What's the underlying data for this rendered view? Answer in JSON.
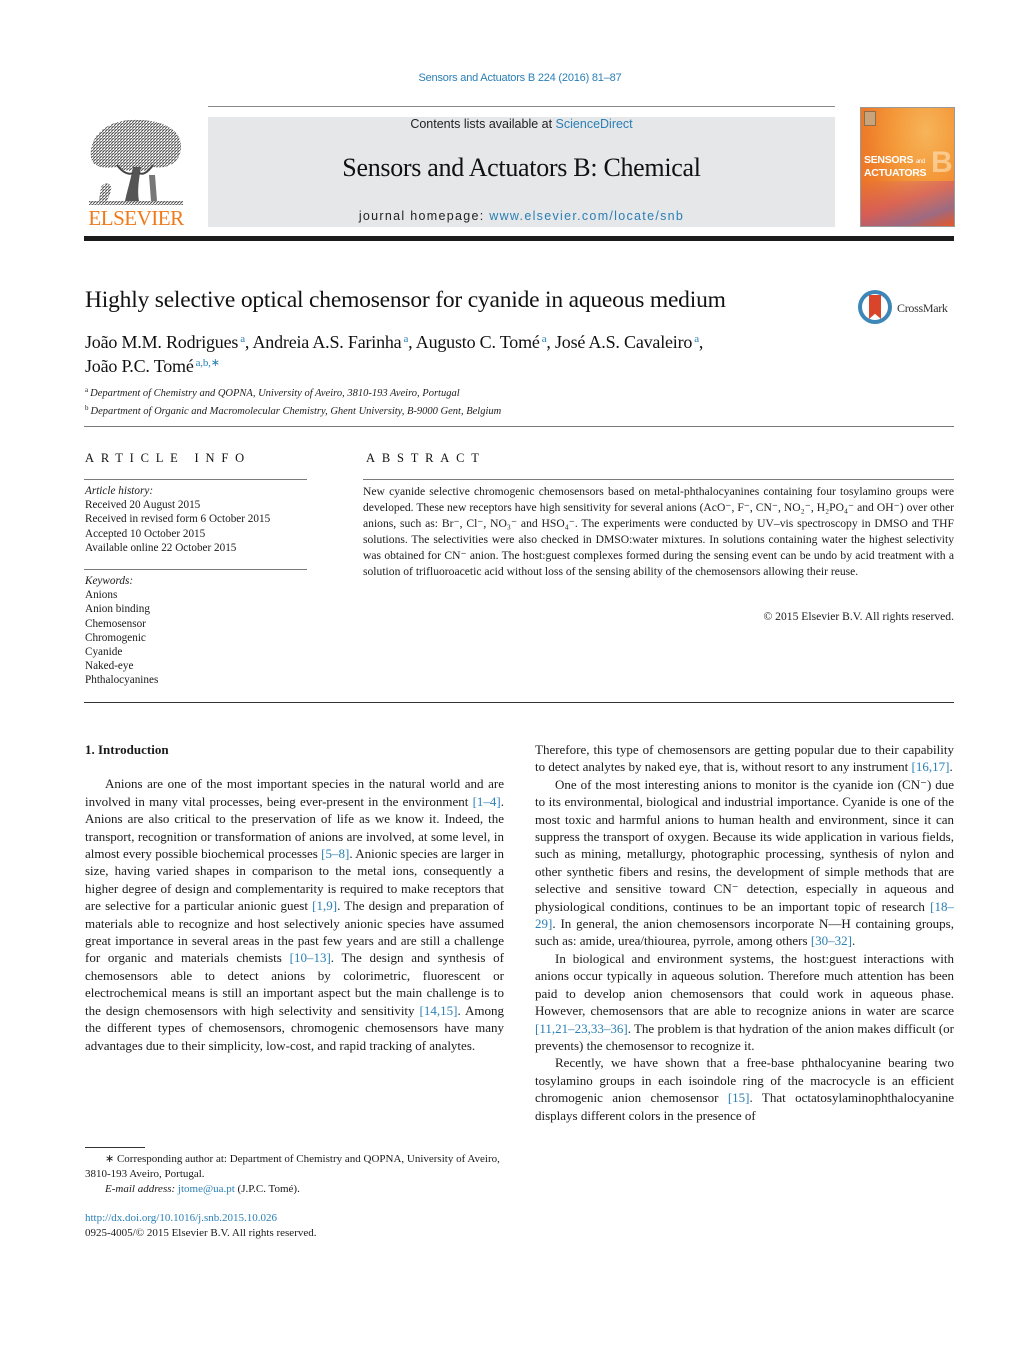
{
  "header": {
    "journal_ref": "Sensors and Actuators B 224 (2016) 81–87",
    "publisher_logo_text": "ELSEVIER",
    "contents_prefix": "Contents lists available at ",
    "contents_link": "ScienceDirect",
    "journal_title": "Sensors and Actuators B: Chemical",
    "homepage_prefix": "journal homepage: ",
    "homepage_link": "www.elsevier.com/locate/snb",
    "cover": {
      "line1": "SENSORS",
      "and": "and",
      "line2": "ACTUATORS",
      "letter": "B"
    }
  },
  "article": {
    "title": "Highly selective optical chemosensor for cyanide in aqueous medium",
    "crossmark_label": "CrossMark",
    "authors": [
      {
        "name": "João M.M. Rodrigues",
        "sup": "a",
        "sep": ", "
      },
      {
        "name": "Andreia A.S. Farinha",
        "sup": "a",
        "sep": ", "
      },
      {
        "name": "Augusto C. Tomé",
        "sup": "a",
        "sep": ", "
      },
      {
        "name": "José A.S. Cavaleiro",
        "sup": "a",
        "sep": ","
      },
      {
        "name": "João P.C. Tomé",
        "sup": "a,b,∗",
        "sep": ""
      }
    ],
    "affiliations": [
      {
        "key": "a",
        "text": "Department of Chemistry and QOPNA, University of Aveiro, 3810-193 Aveiro, Portugal"
      },
      {
        "key": "b",
        "text": "Department of Organic and Macromolecular Chemistry, Ghent University, B-9000 Gent, Belgium"
      }
    ]
  },
  "article_info": {
    "heading": "ARTICLE INFO",
    "history_label": "Article history:",
    "history": [
      "Received 20 August 2015",
      "Received in revised form 6 October 2015",
      "Accepted 10 October 2015",
      "Available online 22 October 2015"
    ],
    "keywords_label": "Keywords:",
    "keywords": [
      "Anions",
      "Anion binding",
      "Chemosensor",
      "Chromogenic",
      "Cyanide",
      "Naked-eye",
      "Phthalocyanines"
    ]
  },
  "abstract": {
    "heading": "ABSTRACT",
    "text": "New cyanide selective chromogenic chemosensors based on metal-phthalocyanines containing four tosylamino groups were developed. These new receptors have high sensitivity for several anions (AcO⁻, F⁻, CN⁻, NO₂⁻, H₂PO₄⁻ and OH⁻) over other anions, such as: Br⁻, Cl⁻, NO₃⁻ and HSO₄⁻. The experiments were conducted by UV–vis spectroscopy in DMSO and THF solutions. The selectivities were also checked in DMSO:water mixtures. In solutions containing water the highest selectivity was obtained for CN⁻ anion. The host:guest complexes formed during the sensing event can be undo by acid treatment with a solution of trifluoroacetic acid without loss of the sensing ability of the chemosensors allowing their reuse.",
    "copyright": "© 2015 Elsevier B.V. All rights reserved."
  },
  "body": {
    "section_heading": "1.  Introduction",
    "left_paragraphs": [
      [
        {
          "t": "Anions are one of the most important species in the natural world and are involved in many vital processes, being ever-present in the environment "
        },
        {
          "ref": "[1–4]"
        },
        {
          "t": ". Anions are also critical to the preservation of life as we know it. Indeed, the transport, recognition or transformation of anions are involved, at some level, in almost every possible biochemical processes "
        },
        {
          "ref": "[5–8]"
        },
        {
          "t": ". Anionic species are larger in size, having varied shapes in comparison to the metal ions, consequently a higher degree of design and complementarity is required to make receptors that are selective for a particular anionic guest "
        },
        {
          "ref": "[1,9]"
        },
        {
          "t": ". The design and preparation of materials able to recognize and host selectively anionic species have assumed great importance in several areas in the past few years and are still a challenge for organic and materials chemists "
        },
        {
          "ref": "[10–13]"
        },
        {
          "t": ". The design and synthesis of chemosensors able to detect anions by colorimetric, fluorescent or electrochemical means is still an important aspect but the main challenge is to the design chemosensors with high selectivity and sensitivity "
        },
        {
          "ref": "[14,15]"
        },
        {
          "t": ". Among the different types of chemosensors, chromogenic chemosensors have many advantages due to their simplicity, low-cost, and rapid tracking of analytes."
        }
      ]
    ],
    "right_paragraphs": [
      [
        {
          "t": "Therefore, this type of chemosensors are getting popular due to their capability to detect analytes by naked eye, that is, without resort to any instrument "
        },
        {
          "ref": "[16,17]"
        },
        {
          "t": "."
        }
      ],
      [
        {
          "t": "One of the most interesting anions to monitor is the cyanide ion (CN⁻) due to its environmental, biological and industrial importance. Cyanide is one of the most toxic and harmful anions to human health and environment, since it can suppress the transport of oxygen. Because its wide application in various fields, such as mining, metallurgy, photographic processing, synthesis of nylon and other synthetic fibers and resins, the development of simple methods that are selective and sensitive toward CN⁻ detection, especially in aqueous and physiological conditions, continues to be an important topic of research "
        },
        {
          "ref": "[18–29]"
        },
        {
          "t": ". In general, the anion chemosensors incorporate N—H containing groups, such as: amide, urea/thiourea, pyrrole, among others "
        },
        {
          "ref": "[30–32]"
        },
        {
          "t": "."
        }
      ],
      [
        {
          "t": "In biological and environment systems, the host:guest interactions with anions occur typically in aqueous solution. Therefore much attention has been paid to develop anion chemosensors that could work in aqueous phase. However, chemosensors that are able to recognize anions in water are scarce "
        },
        {
          "ref": "[11,21–23,33–36]"
        },
        {
          "t": ". The problem is that hydration of the anion makes difficult (or prevents) the chemosensor to recognize it."
        }
      ],
      [
        {
          "t": "Recently, we have shown that a free-base phthalocyanine bearing two tosylamino groups in each isoindole ring of the macrocycle is an efficient chromogenic anion chemosensor "
        },
        {
          "ref": "[15]"
        },
        {
          "t": ". That octatosylaminophthalocyanine displays different colors in the presence of"
        }
      ]
    ]
  },
  "footnote": {
    "marker": "∗",
    "corresponding": " Corresponding author at: Department of Chemistry and QOPNA, University of Aveiro, 3810-193 Aveiro, Portugal.",
    "email_label": "E-mail address:",
    "email": "jtome@ua.pt",
    "email_suffix": " (J.P.C. Tomé)."
  },
  "doi": {
    "link": "http://dx.doi.org/10.1016/j.snb.2015.10.026",
    "issn_line": "0925-4005/© 2015 Elsevier B.V. All rights reserved."
  },
  "colors": {
    "link": "#2a7fb5",
    "elsevier_orange": "#f07a1a",
    "banner_bg": "#e6e7e9",
    "crossmark_blue": "#3c86b8",
    "crossmark_red": "#d9452b"
  }
}
